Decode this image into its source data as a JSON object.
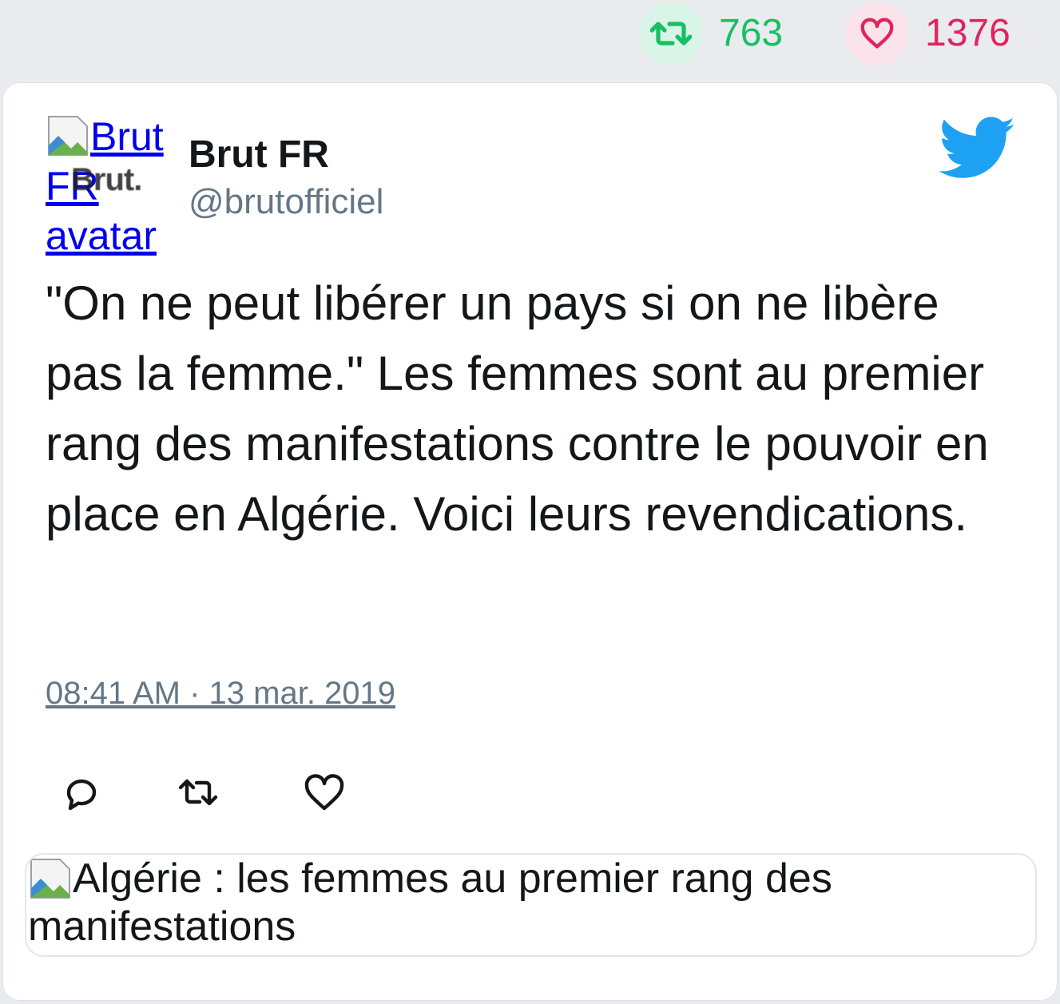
{
  "stats": {
    "retweet_count": "763",
    "like_count": "1376",
    "retweet_color": "#17bf63",
    "like_color": "#e0245e"
  },
  "author": {
    "avatar_alt": "Brut FR avatar",
    "avatar_logo_text": "Brut.",
    "display_name": "Brut FR",
    "handle": "@brutofficiel"
  },
  "tweet": {
    "text": "\"On ne peut libérer un pays si on ne libère pas la femme.\" Les femmes sont au premier rang des manifestations contre le pouvoir en place en Algérie. Voici leurs revendications.",
    "timestamp": "08:41 AM · 13 mar. 2019"
  },
  "actions": {
    "icons": [
      "reply-icon",
      "retweet-icon",
      "like-icon"
    ]
  },
  "link_card": {
    "image_alt": "Algérie : les femmes au premier rang des manifestations"
  },
  "brand": {
    "twitter_blue": "#1da1f2"
  }
}
